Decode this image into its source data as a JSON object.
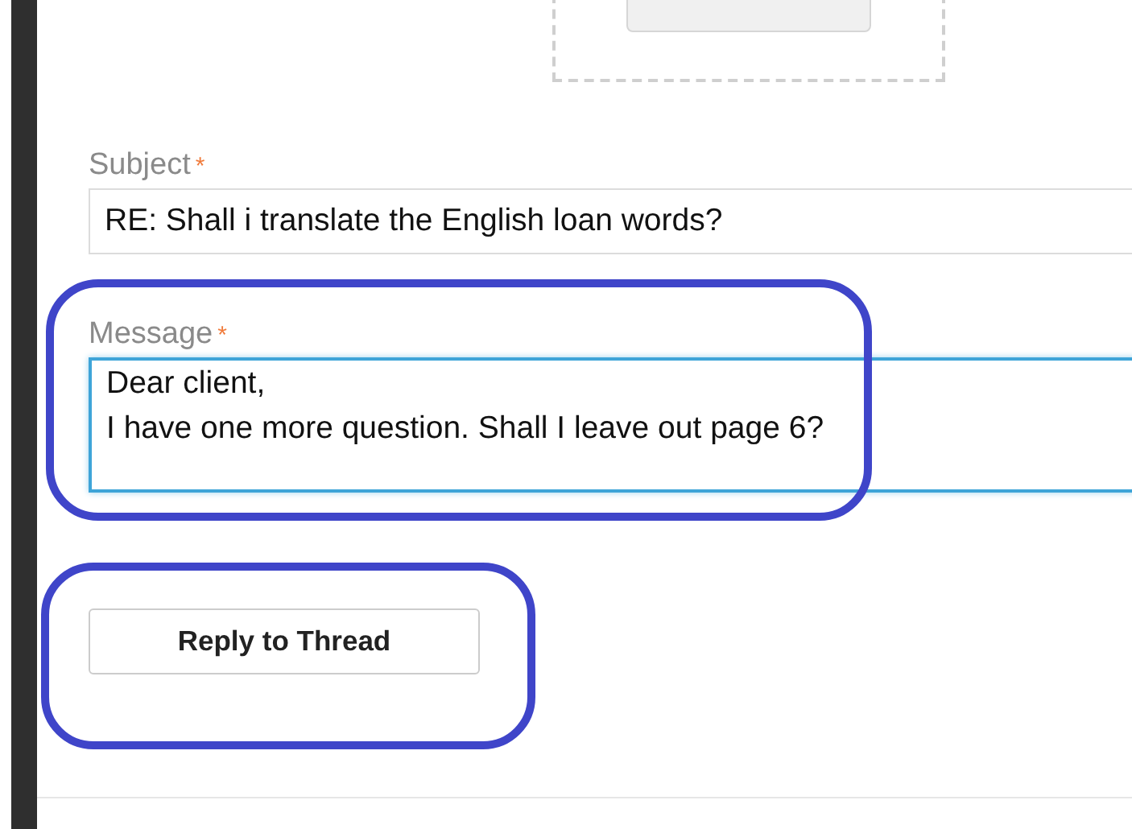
{
  "upload": {
    "kind": "dropzone"
  },
  "fields": [
    {
      "kind": "input",
      "label": "Subject",
      "required_mark": "*",
      "value": "RE: Shall i translate the English loan words?",
      "focused": false
    },
    {
      "kind": "textarea",
      "label": "Message",
      "required_mark": "*",
      "value": "Dear client,\nI have one more question. Shall I leave out page 6?",
      "focused": true
    }
  ],
  "submit_button": {
    "label": "Reply to Thread"
  }
}
